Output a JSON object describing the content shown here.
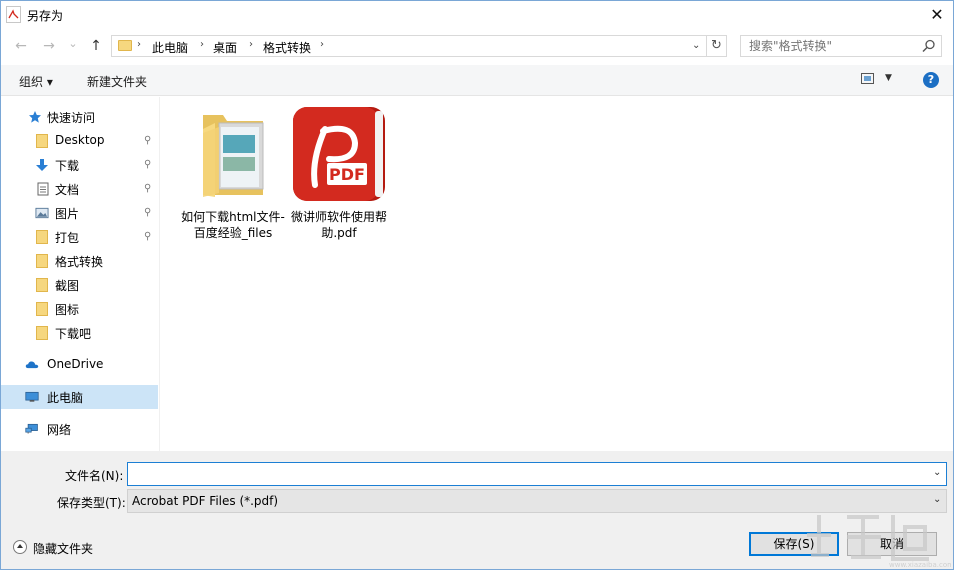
{
  "window": {
    "title": "另存为",
    "close": "✕"
  },
  "nav": {
    "back": "←",
    "forward": "→",
    "recent": "⌄",
    "up": "↑",
    "breadcrumb": [
      "此电脑",
      "桌面",
      "格式转换"
    ],
    "refresh": "↻",
    "search_placeholder": "搜索\"格式转换\""
  },
  "toolbar": {
    "organize": "组织 ▾",
    "new_folder": "新建文件夹",
    "help": "?"
  },
  "sidebar": {
    "quick_access": "快速访问",
    "items": [
      {
        "label": "Desktop",
        "icon": "folder-icon",
        "pinned": true
      },
      {
        "label": "下载",
        "icon": "download-icon",
        "pinned": true
      },
      {
        "label": "文档",
        "icon": "document-icon",
        "pinned": true
      },
      {
        "label": "图片",
        "icon": "picture-icon",
        "pinned": true
      },
      {
        "label": "打包",
        "icon": "folder-icon",
        "pinned": true
      },
      {
        "label": "格式转换",
        "icon": "folder-icon",
        "pinned": false
      },
      {
        "label": "截图",
        "icon": "folder-icon",
        "pinned": false
      },
      {
        "label": "图标",
        "icon": "folder-icon",
        "pinned": false
      },
      {
        "label": "下载吧",
        "icon": "folder-icon",
        "pinned": false
      }
    ],
    "onedrive": "OneDrive",
    "this_pc": "此电脑",
    "network": "网络",
    "pin_glyph": "📌"
  },
  "files": [
    {
      "name": "如何下载html文件-百度经验_files",
      "type": "folder"
    },
    {
      "name": "微讲师软件使用帮助.pdf",
      "type": "pdf",
      "badge": "PDF"
    }
  ],
  "form": {
    "filename_label": "文件名(N):",
    "filename_value": "",
    "filetype_label": "保存类型(T):",
    "filetype_value": "Acrobat PDF Files (*.pdf)"
  },
  "footer": {
    "hide_folders": "隐藏文件夹",
    "save": "保存(S)",
    "cancel": "取消"
  },
  "colors": {
    "accent": "#0078d7",
    "selection": "#cce4f7",
    "folder": "#f6d77f",
    "pdf_red": "#d32a1f"
  }
}
